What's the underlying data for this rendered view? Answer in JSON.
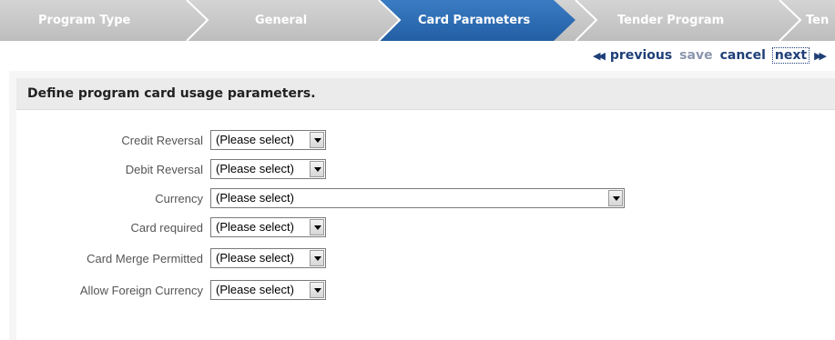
{
  "wizard": {
    "steps": [
      {
        "label": "Program Type",
        "state": "inactive"
      },
      {
        "label": "General",
        "state": "inactive"
      },
      {
        "label": "Card Parameters",
        "state": "active"
      },
      {
        "label": "Tender Program",
        "state": "inactive"
      },
      {
        "label": "Ten",
        "state": "inactive"
      }
    ]
  },
  "nav": {
    "prev_arrows": "◀◀",
    "previous": "previous",
    "save": "save",
    "cancel": "cancel",
    "next": "next",
    "next_arrows": "▶▶"
  },
  "panel": {
    "title": "Define program card usage parameters."
  },
  "form": {
    "fields": [
      {
        "label": "Credit Reversal",
        "value": "(Please select)"
      },
      {
        "label": "Debit Reversal",
        "value": "(Please select)"
      },
      {
        "label": "Currency",
        "value": "(Please select)"
      },
      {
        "label": "Card required",
        "value": "(Please select)"
      },
      {
        "label": "Card Merge Permitted",
        "value": "(Please select)"
      },
      {
        "label": "Allow Foreign Currency",
        "value": "(Please select)"
      }
    ]
  },
  "colors": {
    "step_inactive": "#c5c5c5",
    "step_active": "#2f6db5",
    "nav_link": "#1f3f78",
    "nav_disabled": "#8b96ad"
  }
}
